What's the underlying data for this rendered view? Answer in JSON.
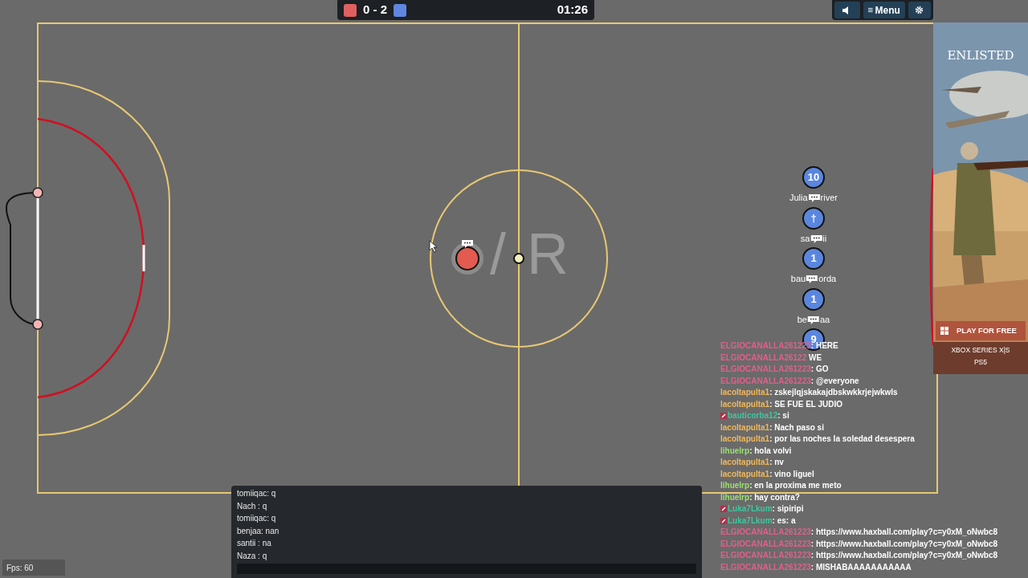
{
  "scoreboard": {
    "score": "0 - 2",
    "time": "01:26"
  },
  "top_buttons": [
    {
      "kind": "sound"
    },
    {
      "kind": "menu",
      "label": "Menu"
    },
    {
      "kind": "settings"
    }
  ],
  "field": {
    "logo_slash": "/",
    "logo_letter": "R"
  },
  "red_players": [
    {
      "typing": true
    }
  ],
  "blue_players": [
    {
      "number": "10",
      "name_start": "Julia",
      "name_end": "river",
      "typing": true
    },
    {
      "number": "†",
      "name_start": "sa",
      "name_end": "ii",
      "typing": true
    },
    {
      "number": "1",
      "name_start": "bau",
      "name_end": "orda",
      "typing": true
    },
    {
      "number": "1",
      "name_start": "be",
      "name_end": "aa",
      "typing": true
    },
    {
      "number": "9",
      "typing": false
    }
  ],
  "room_chat": [
    {
      "sender": "ELGIOCANALLA261223",
      "color": "#e0608a",
      "badge": false,
      "text": ": HERE"
    },
    {
      "sender": "ELGIOCANALLA26122",
      "color": "#e0608a",
      "badge": false,
      "text": " WE"
    },
    {
      "sender": "ELGIOCANALLA261223",
      "color": "#e0608a",
      "badge": false,
      "text": ": GO"
    },
    {
      "sender": "ELGIOCANALLA261223",
      "color": "#e0608a",
      "badge": false,
      "text": ": @everyone"
    },
    {
      "sender": "lacoltapulta1",
      "color": "#f0b85a",
      "badge": false,
      "text": ": zskejlqjskakajdbskwkkrjejwkwls"
    },
    {
      "sender": "lacoltapulta1",
      "color": "#f0b85a",
      "badge": false,
      "text": ": SE FUE EL JUDIO"
    },
    {
      "sender": "bauticorba12",
      "color": "#3cc8a0",
      "badge": true,
      "text": ": si"
    },
    {
      "sender": "lacoltapulta1",
      "color": "#f0b85a",
      "badge": false,
      "text": ": Nach paso si"
    },
    {
      "sender": "lacoltapulta1",
      "color": "#f0b85a",
      "badge": false,
      "text": ": por las noches la soledad desespera"
    },
    {
      "sender": "lihuelrp",
      "color": "#9be070",
      "badge": false,
      "text": ": hola volvi"
    },
    {
      "sender": "lacoltapulta1",
      "color": "#f0b85a",
      "badge": false,
      "text": ": nv"
    },
    {
      "sender": "lacoltapulta1",
      "color": "#f0b85a",
      "badge": false,
      "text": ": vino liguel"
    },
    {
      "sender": "lihuelrp",
      "color": "#9be070",
      "badge": false,
      "text": ": en la proxima me meto"
    },
    {
      "sender": "lihuelrp",
      "color": "#9be070",
      "badge": false,
      "text": ": hay contra?"
    },
    {
      "sender": "Luka7Lkum",
      "color": "#3cc8a0",
      "badge": true,
      "text": ": sipiripi"
    },
    {
      "sender": "Luka7Lkum",
      "color": "#3cc8a0",
      "badge": true,
      "text": ": es: a"
    },
    {
      "sender": "ELGIOCANALLA261223",
      "color": "#e0608a",
      "badge": false,
      "text": ": https://www.haxball.com/play?c=y0xM_oNwbc8"
    },
    {
      "sender": "ELGIOCANALLA261223",
      "color": "#e0608a",
      "badge": false,
      "text": ": https://www.haxball.com/play?c=y0xM_oNwbc8"
    },
    {
      "sender": "ELGIOCANALLA261223",
      "color": "#e0608a",
      "badge": false,
      "text": ": https://www.haxball.com/play?c=y0xM_oNwbc8"
    },
    {
      "sender": "ELGIOCANALLA261223",
      "color": "#e0608a",
      "badge": false,
      "text": ": MISHABAAAAAAAAAAA"
    }
  ],
  "game_chat": {
    "lines": [
      "tomiiqac: q",
      "Nach : q",
      "tomiiqac: q",
      "benjaa: nan",
      "santii : na",
      "Naza : q"
    ]
  },
  "fps": "Fps: 60",
  "ad": {
    "kind": "picture",
    "logo": "ENLISTED",
    "button": "PLAY FOR FREE",
    "platforms": [
      "XBOX SERIES X|S",
      "PS5"
    ]
  }
}
